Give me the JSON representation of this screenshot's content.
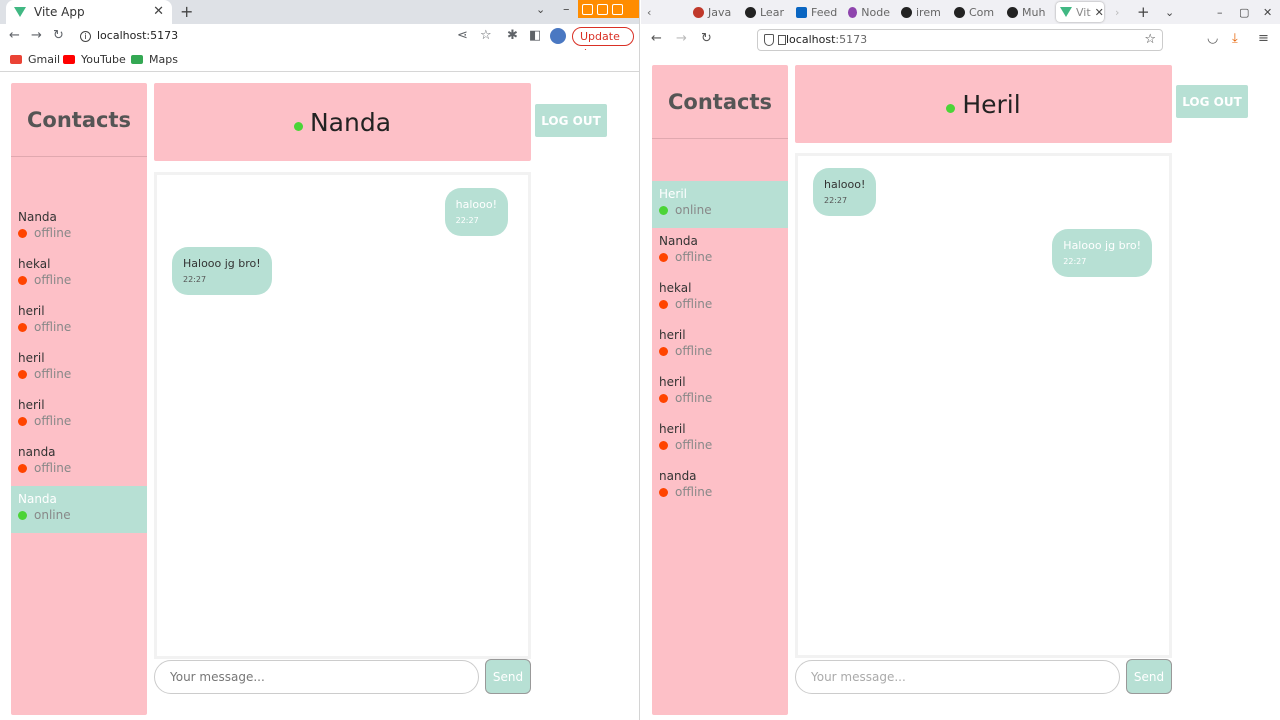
{
  "left_window": {
    "tab_title": "Vite App",
    "url": "localhost:5173",
    "update_label": "Update",
    "bookmarks": [
      "Gmail",
      "YouTube",
      "Maps"
    ],
    "app": {
      "contacts_title": "Contacts",
      "contacts": [
        {
          "name": "Nanda",
          "status": "offline"
        },
        {
          "name": "hekal",
          "status": "offline"
        },
        {
          "name": "heril",
          "status": "offline"
        },
        {
          "name": "heril",
          "status": "offline"
        },
        {
          "name": "heril",
          "status": "offline"
        },
        {
          "name": "nanda",
          "status": "offline"
        },
        {
          "name": "Nanda",
          "status": "online"
        }
      ],
      "chat_with": "Nanda",
      "logout_label": "LOG OUT",
      "messages": [
        {
          "text": "halooo!",
          "time": "22:27",
          "side": "right"
        },
        {
          "text": "Halooo jg bro!",
          "time": "22:27",
          "side": "left"
        }
      ],
      "input_placeholder": "Your message...",
      "send_label": "Send"
    }
  },
  "right_window": {
    "tabs": [
      "Java",
      "Lear",
      "Feed",
      "Node",
      "irem",
      "Com",
      "Muh",
      "Vit"
    ],
    "url_host": "localhost",
    "url_port": ":5173",
    "app": {
      "contacts_title": "Contacts",
      "contacts": [
        {
          "name": "Heril",
          "status": "online"
        },
        {
          "name": "Nanda",
          "status": "offline"
        },
        {
          "name": "hekal",
          "status": "offline"
        },
        {
          "name": "heril",
          "status": "offline"
        },
        {
          "name": "heril",
          "status": "offline"
        },
        {
          "name": "heril",
          "status": "offline"
        },
        {
          "name": "nanda",
          "status": "offline"
        }
      ],
      "chat_with": "Heril",
      "logout_label": "LOG OUT",
      "messages": [
        {
          "text": "halooo!",
          "time": "22:27",
          "side": "left"
        },
        {
          "text": "Halooo jg bro!",
          "time": "22:27",
          "side": "right"
        }
      ],
      "input_placeholder": "Your message...",
      "send_label": "Send"
    }
  },
  "colors": {
    "pink": "#fdc0c7",
    "mint": "#b7e0d4",
    "online": "#4bd437",
    "offline": "#ff4400"
  }
}
